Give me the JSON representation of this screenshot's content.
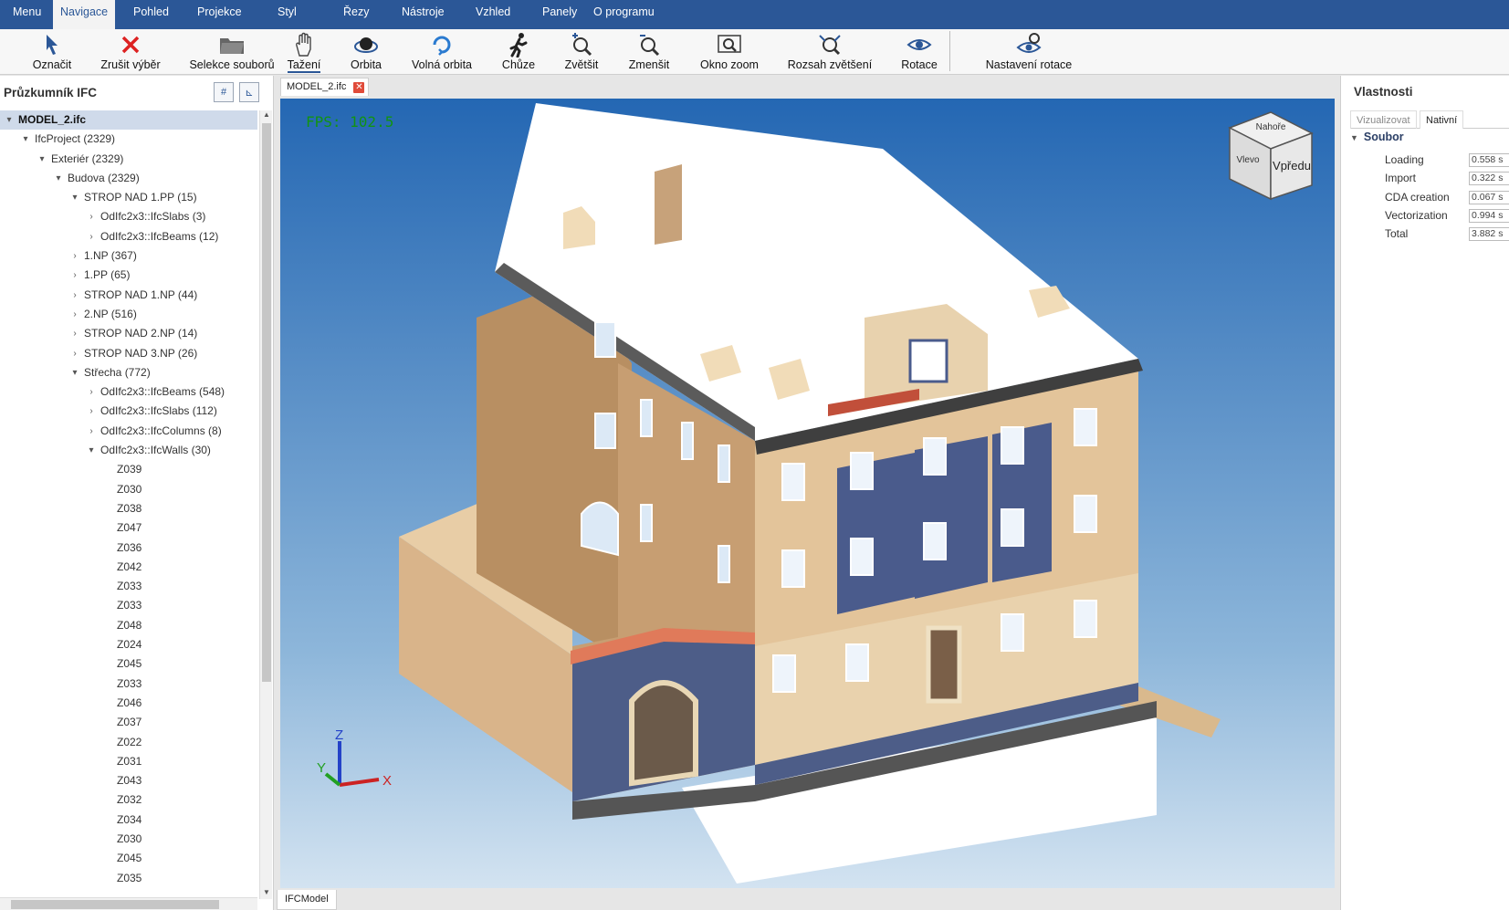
{
  "menu": {
    "items": [
      {
        "label": "Menu"
      },
      {
        "label": "Navigace"
      },
      {
        "label": "Pohled"
      },
      {
        "label": "Projekce"
      },
      {
        "label": "Styl"
      },
      {
        "label": "Řezy"
      },
      {
        "label": "Nástroje"
      },
      {
        "label": "Vzhled"
      },
      {
        "label": "Panely"
      },
      {
        "label": "O programu"
      }
    ],
    "active": "Navigace"
  },
  "toolbar": {
    "tools": [
      {
        "label": "Označit",
        "icon": "select-cursor-icon"
      },
      {
        "label": "Zrušit výběr",
        "icon": "red-x-icon"
      },
      {
        "label": "Selekce souborů",
        "icon": "folder-icon"
      },
      {
        "label": "Tažení",
        "icon": "hand-pan-icon"
      },
      {
        "label": "Orbita",
        "icon": "orbit-icon"
      },
      {
        "label": "Volná orbita",
        "icon": "free-orbit-icon"
      },
      {
        "label": "Chůze",
        "icon": "walk-icon"
      },
      {
        "label": "Zvětšit",
        "icon": "zoom-in-icon"
      },
      {
        "label": "Zmenšit",
        "icon": "zoom-out-icon"
      },
      {
        "label": "Okno zoom",
        "icon": "zoom-window-icon"
      },
      {
        "label": "Rozsah zvětšení",
        "icon": "zoom-extents-icon"
      },
      {
        "label": "Rotace",
        "icon": "rotate-eye-icon"
      },
      {
        "label": "Nastavení rotace",
        "icon": "rotation-settings-icon"
      }
    ],
    "active": "Tažení"
  },
  "explorer": {
    "title": "Průzkumník IFC",
    "nodes": [
      {
        "label": "MODEL_2.ifc",
        "level": 0,
        "toggle": "expanded",
        "selected": true
      },
      {
        "label": "IfcProject (2329)",
        "level": 1,
        "toggle": "expanded"
      },
      {
        "label": "Exteriér (2329)",
        "level": 2,
        "toggle": "expanded"
      },
      {
        "label": "Budova (2329)",
        "level": 3,
        "toggle": "expanded"
      },
      {
        "label": "STROP NAD 1.PP (15)",
        "level": 4,
        "toggle": "expanded"
      },
      {
        "label": "OdIfc2x3::IfcSlabs (3)",
        "level": 5,
        "toggle": "collapsed"
      },
      {
        "label": "OdIfc2x3::IfcBeams (12)",
        "level": 5,
        "toggle": "collapsed"
      },
      {
        "label": "1.NP (367)",
        "level": 4,
        "toggle": "collapsed"
      },
      {
        "label": "1.PP (65)",
        "level": 4,
        "toggle": "collapsed"
      },
      {
        "label": "STROP NAD 1.NP (44)",
        "level": 4,
        "toggle": "collapsed"
      },
      {
        "label": "2.NP (516)",
        "level": 4,
        "toggle": "collapsed"
      },
      {
        "label": "STROP NAD 2.NP (14)",
        "level": 4,
        "toggle": "collapsed"
      },
      {
        "label": "STROP NAD 3.NP (26)",
        "level": 4,
        "toggle": "collapsed"
      },
      {
        "label": "Střecha (772)",
        "level": 4,
        "toggle": "expanded"
      },
      {
        "label": "OdIfc2x3::IfcBeams (548)",
        "level": 5,
        "toggle": "collapsed"
      },
      {
        "label": "OdIfc2x3::IfcSlabs (112)",
        "level": 5,
        "toggle": "collapsed"
      },
      {
        "label": "OdIfc2x3::IfcColumns (8)",
        "level": 5,
        "toggle": "collapsed"
      },
      {
        "label": "OdIfc2x3::IfcWalls (30)",
        "level": 5,
        "toggle": "expanded"
      },
      {
        "label": "Z039",
        "level": 6,
        "toggle": "none"
      },
      {
        "label": "Z030",
        "level": 6,
        "toggle": "none"
      },
      {
        "label": "Z038",
        "level": 6,
        "toggle": "none"
      },
      {
        "label": "Z047",
        "level": 6,
        "toggle": "none"
      },
      {
        "label": "Z036",
        "level": 6,
        "toggle": "none"
      },
      {
        "label": "Z042",
        "level": 6,
        "toggle": "none"
      },
      {
        "label": "Z033",
        "level": 6,
        "toggle": "none"
      },
      {
        "label": "Z033",
        "level": 6,
        "toggle": "none"
      },
      {
        "label": "Z048",
        "level": 6,
        "toggle": "none"
      },
      {
        "label": "Z024",
        "level": 6,
        "toggle": "none"
      },
      {
        "label": "Z045",
        "level": 6,
        "toggle": "none"
      },
      {
        "label": "Z033",
        "level": 6,
        "toggle": "none"
      },
      {
        "label": "Z046",
        "level": 6,
        "toggle": "none"
      },
      {
        "label": "Z037",
        "level": 6,
        "toggle": "none"
      },
      {
        "label": "Z022",
        "level": 6,
        "toggle": "none"
      },
      {
        "label": "Z031",
        "level": 6,
        "toggle": "none"
      },
      {
        "label": "Z043",
        "level": 6,
        "toggle": "none"
      },
      {
        "label": "Z032",
        "level": 6,
        "toggle": "none"
      },
      {
        "label": "Z034",
        "level": 6,
        "toggle": "none"
      },
      {
        "label": "Z030",
        "level": 6,
        "toggle": "none"
      },
      {
        "label": "Z045",
        "level": 6,
        "toggle": "none"
      },
      {
        "label": "Z035",
        "level": 6,
        "toggle": "none"
      }
    ]
  },
  "document": {
    "tab_label": "MODEL_2.ifc",
    "fps": "FPS: 102.5",
    "navcube": {
      "top": "Nahoře",
      "front": "Vpředu",
      "left": "Vlevo"
    },
    "axes": {
      "x": "X",
      "y": "Y",
      "z": "Z"
    },
    "bottom_tab": "IFCModel"
  },
  "properties": {
    "title": "Vlastnosti",
    "tabs": [
      "Vizualizovat",
      "Nativní"
    ],
    "active_tab": "Nativní",
    "group": "Soubor",
    "rows": [
      {
        "name": "Loading",
        "value": "0.558 s"
      },
      {
        "name": "Import",
        "value": "0.322 s"
      },
      {
        "name": "CDA creation",
        "value": "0.067 s"
      },
      {
        "name": "Vectorization",
        "value": "0.994 s"
      },
      {
        "name": "Total",
        "value": "3.882 s"
      }
    ]
  },
  "colors": {
    "accent": "#2b5797",
    "viewport_top": "#2467b3",
    "viewport_bottom": "#d3e3f1",
    "facade": "#e3c49a",
    "facade_blue": "#4a5b8c",
    "roof": "#ffffff",
    "fps_text": "#129312"
  }
}
